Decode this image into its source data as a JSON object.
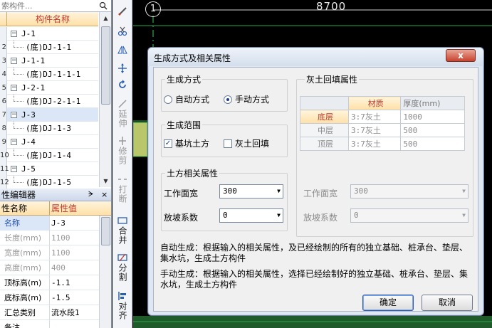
{
  "tree": {
    "search_placeholder": "索构件...",
    "header": "构件名称",
    "rows": [
      {
        "no": "",
        "label": "J-1",
        "type": "parent"
      },
      {
        "no": "2",
        "label": "(底)DJ-1-1",
        "type": "child"
      },
      {
        "no": "3",
        "label": "J-1-1",
        "type": "parent"
      },
      {
        "no": "4",
        "label": "(底)DJ-1-1-1",
        "type": "child"
      },
      {
        "no": "5",
        "label": "J-2-1",
        "type": "parent"
      },
      {
        "no": "6",
        "label": "(底)DJ-2-1-1",
        "type": "child"
      },
      {
        "no": "7",
        "label": "J-3",
        "type": "parent"
      },
      {
        "no": "8",
        "label": "(底)DJ-1-3",
        "type": "child"
      },
      {
        "no": "9",
        "label": "J-4",
        "type": "parent"
      },
      {
        "no": "10",
        "label": "(底)DJ-1-4",
        "type": "child"
      },
      {
        "no": "11",
        "label": "J-5",
        "type": "parent"
      },
      {
        "no": "12",
        "label": "(底)DJ-1-5",
        "type": "child"
      }
    ]
  },
  "props": {
    "title": "性编辑器",
    "pin": "ᗒ",
    "close": "×",
    "col_name": "性名称",
    "col_value": "属性值",
    "rows": [
      {
        "name": "名称",
        "value": "J-3",
        "disabled": false,
        "hl": true
      },
      {
        "name": "长度(mm)",
        "value": "1100",
        "disabled": true,
        "hl": false
      },
      {
        "name": "宽度(mm)",
        "value": "1100",
        "disabled": true,
        "hl": false
      },
      {
        "name": "高度(mm)",
        "value": "400",
        "disabled": true,
        "hl": false
      },
      {
        "name": "顶标高(m)",
        "value": "-1.1",
        "disabled": false,
        "hl": false
      },
      {
        "name": "底标高(m)",
        "value": "-1.5",
        "disabled": false,
        "hl": false
      },
      {
        "name": "汇总类别",
        "value": "流水段1",
        "disabled": false,
        "hl": false
      },
      {
        "name": "备注",
        "value": "",
        "disabled": false,
        "hl": false
      }
    ]
  },
  "toolbar": {
    "extend": "延伸",
    "trim": "修剪",
    "break": "打断",
    "merge": "合并",
    "split": "分割",
    "align": "对齐"
  },
  "canvas": {
    "dimension": "8700",
    "axis": "1"
  },
  "dialog": {
    "title": "生成方式及相关属性",
    "close": "x",
    "method": {
      "label": "生成方式",
      "auto": "自动方式",
      "manual": "手动方式",
      "selected": "manual"
    },
    "range": {
      "label": "生成范围",
      "pit": "基坑土方",
      "backfill": "灰土回填",
      "pit_checked": true,
      "backfill_checked": false
    },
    "earth": {
      "label": "土方相关属性",
      "width_label": "工作面宽",
      "width_value": "300",
      "slope_label": "放坡系数",
      "slope_value": "0"
    },
    "fill": {
      "label": "灰土回填属性",
      "col_material": "材质",
      "col_thickness": "厚度(mm)",
      "rows": [
        {
          "name": "底层",
          "material": "3:7灰土",
          "thickness": "1000"
        },
        {
          "name": "中层",
          "material": "3:7灰土",
          "thickness": "500"
        },
        {
          "name": "顶层",
          "material": "3:7灰土",
          "thickness": "500"
        }
      ],
      "width_label": "工作面宽",
      "width_value": "300",
      "slope_label": "放坡系数",
      "slope_value": "0"
    },
    "desc_auto": "自动生成：根据输入的相关属性，及已经绘制的所有的独立基础、桩承台、垫层、集水坑，生成土方构件",
    "desc_manual": "手动生成：根据输入的相关属性，选择已经绘制好的独立基础、桩承台、垫层、集水坑，生成土方构件",
    "ok": "确定",
    "cancel": "取消"
  },
  "colors": {
    "accent_red": "#c0392b",
    "canvas_bg": "#000000",
    "grid_green": "#2ea84a",
    "dialog_bg": "#f0f0f0"
  }
}
